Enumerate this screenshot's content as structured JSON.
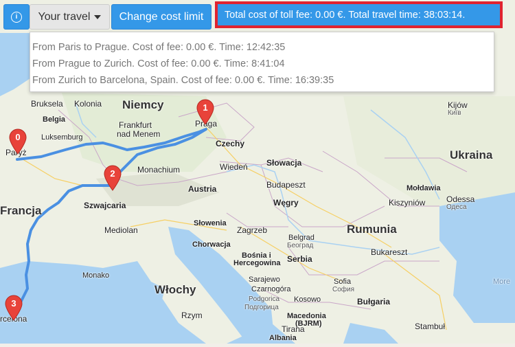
{
  "toolbar": {
    "info_icon": "info-icon",
    "travel_label": "Your travel",
    "limit_label": "Change cost limit"
  },
  "summary": "Total cost of toll fee: 0.00 €. Total travel time: 38:03:14.",
  "legs": [
    "From Paris to Prague. Cost of fee: 0.00 €. Time: 12:42:35",
    "From Prague to Zurich. Cost of fee: 0.00 €. Time: 8:41:04",
    "From Zurich to Barcelona, Spain. Cost of fee: 0.00 €. Time: 16:39:35"
  ],
  "markers": [
    "0",
    "1",
    "2",
    "3"
  ],
  "map_labels": {
    "niemcy": "Niemcy",
    "francja": "Francja",
    "wlochy": "Włochy",
    "rumunia": "Rumunia",
    "ukraina": "Ukraina",
    "czechy": "Czechy",
    "austria": "Austria",
    "wegry": "Węgry",
    "slowacja": "Słowacja",
    "szwajcaria": "Szwajcaria",
    "slowenia": "Słowenia",
    "chorwacja": "Chorwacja",
    "bosnia1": "Bośnia i",
    "bosnia2": "Hercegowina",
    "serbia": "Serbia",
    "bulgaria": "Bułgaria",
    "moldawia": "Mołdawia",
    "macedonia": "Macedonia",
    "bjrm": "(BJRM)",
    "albania": "Albania",
    "belgia": "Belgia",
    "luksemburg": "Luksemburg",
    "monako": "Monako",
    "bruksela": "Bruksela",
    "kolonia": "Kolonia",
    "frankfurt1": "Frankfurt",
    "frankfurt2": "nad Menem",
    "praga": "Praga",
    "paryz": "Paryż",
    "monachium": "Monachium",
    "wieden": "Wiedeń",
    "budapeszt": "Budapeszt",
    "mediolan": "Mediolan",
    "zagrzeb": "Zagrzeb",
    "belgrad": "Belgrad",
    "belgrad_cyr": "Београд",
    "sarajewo": "Sarajewo",
    "czarnogora": "Czarnogóra",
    "podgorica": "Podgorica",
    "podgorica_cyr": "Подгорица",
    "kosowo": "Kosowo",
    "sofia": "Sofia",
    "sofia_cyr": "София",
    "bukareszt": "Bukareszt",
    "kiszyniow": "Kiszyniów",
    "odessa": "Odessa",
    "odessa_cyr": "Одеса",
    "kijow": "Kijów",
    "kijow_cyr": "Київ",
    "rzym": "Rzym",
    "tirana": "Tirana",
    "stambul": "Stambuł",
    "barcelona": "rcelona",
    "morze": "More"
  },
  "colors": {
    "primary": "#3498e8",
    "highlight_border": "#e0232f",
    "route": "#4a90e2",
    "marker": "#e8433a",
    "sea": "#a9d1f2",
    "land": "#f2efe9"
  }
}
